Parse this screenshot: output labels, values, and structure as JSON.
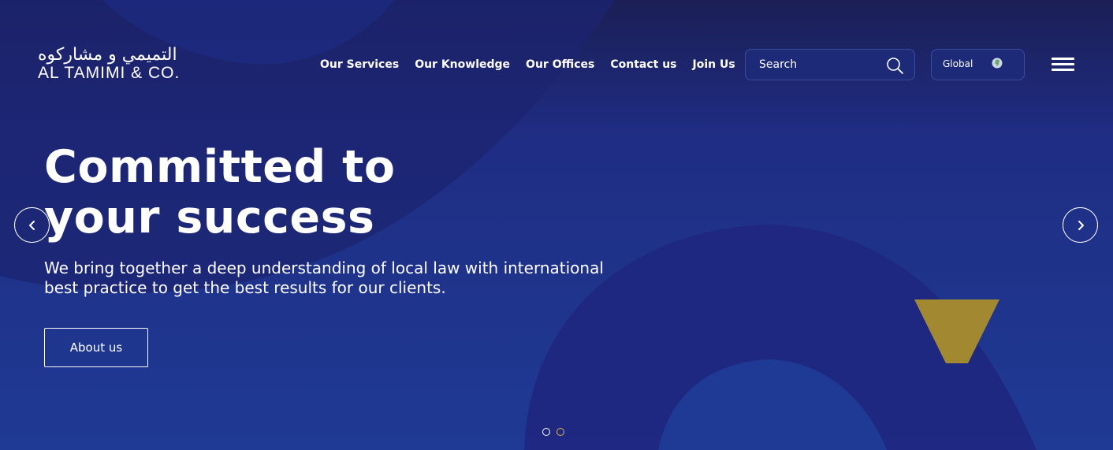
{
  "brand": {
    "logo_arabic": "التميمي و مشاركوه",
    "logo_english": "AL TAMIMI & CO."
  },
  "nav": {
    "items": [
      {
        "label": "Our Services"
      },
      {
        "label": "Our Knowledge"
      },
      {
        "label": "Our Offices"
      },
      {
        "label": "Contact us"
      },
      {
        "label": "Join Us"
      }
    ]
  },
  "search": {
    "placeholder": "Search",
    "icon": "search-icon"
  },
  "region": {
    "label": "Global",
    "icon": "globe-icon"
  },
  "menu": {
    "icon": "hamburger-menu-icon"
  },
  "hero": {
    "headline_line1": "Committed to",
    "headline_line2": "your success",
    "subtext_line1": "We bring together a deep understanding of local law with international",
    "subtext_line2": "best practice to get the best results for our clients.",
    "cta_label": "About us"
  },
  "carousel": {
    "prev_icon": "chevron-left-icon",
    "next_icon": "chevron-right-icon",
    "slide_count": 2,
    "active_slide": 2
  },
  "colors": {
    "background": "#1f3a94",
    "background_dark": "#1b1f55",
    "accent_gold": "#a38832",
    "dot_active": "#e2b04a"
  }
}
